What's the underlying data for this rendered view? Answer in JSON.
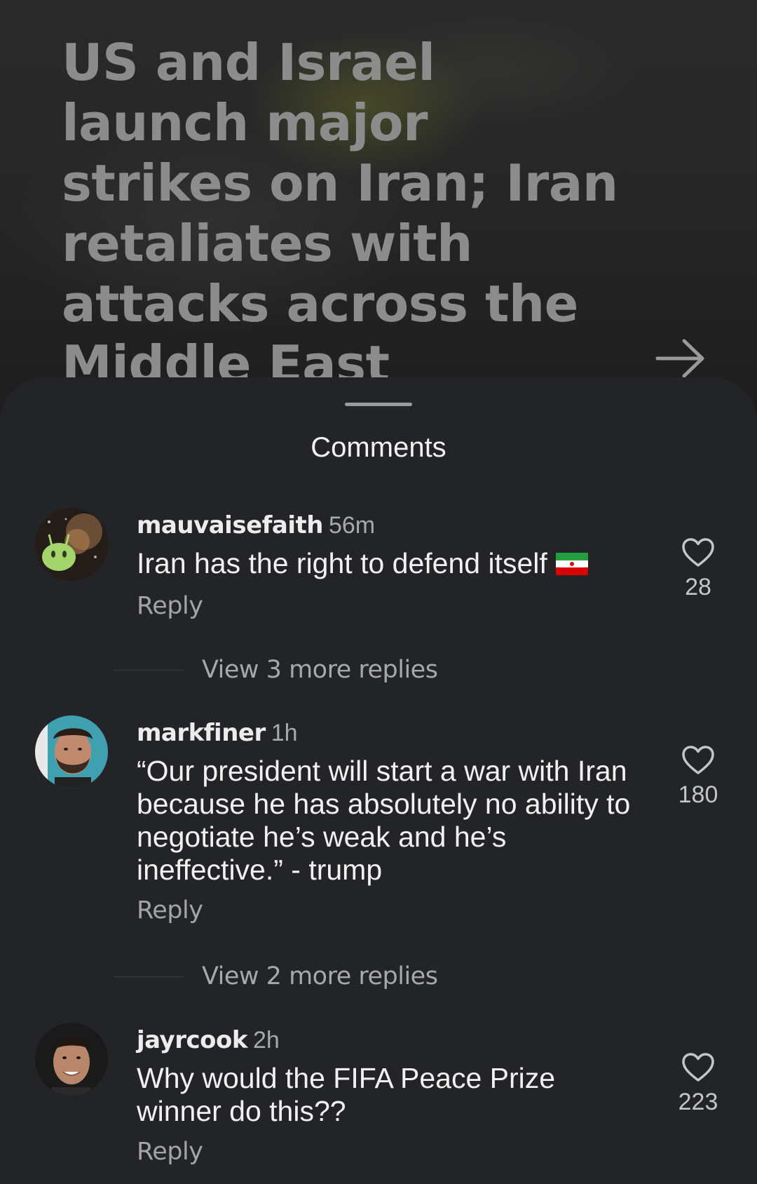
{
  "article": {
    "headline": "US and Israel launch major strikes on Iran; Iran retaliates with attacks across the Middle East",
    "open_icon": "arrow-right-icon"
  },
  "comments_sheet": {
    "title": "Comments",
    "like_icon": "heart-outline-icon",
    "comments": [
      {
        "username": "mauvaisefaith",
        "time": "56m",
        "text": "Iran has the right to defend itself",
        "emoji": "iran-flag",
        "reply_label": "Reply",
        "likes": "28",
        "more_replies": "View 3 more replies"
      },
      {
        "username": "markfiner",
        "time": "1h",
        "text": "“Our president will start a war with Iran because he has absolutely no ability to negotiate he’s weak and he’s ineffective.” - trump",
        "reply_label": "Reply",
        "likes": "180",
        "more_replies": "View 2 more replies"
      },
      {
        "username": "jayrcook",
        "time": "2h",
        "text": "Why would the FIFA Peace Prize winner do this??",
        "reply_label": "Reply",
        "likes": "223"
      }
    ]
  }
}
